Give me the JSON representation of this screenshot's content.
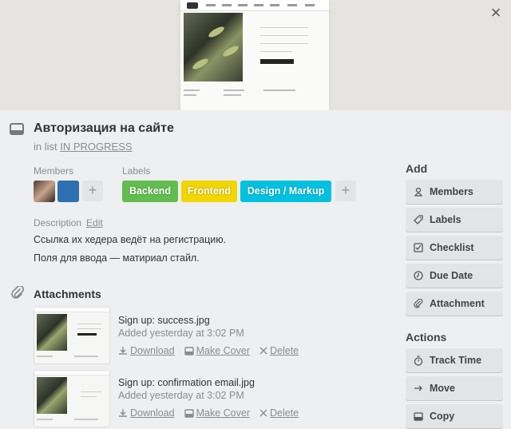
{
  "card": {
    "title": "Авторизация на сайте",
    "in_list_prefix": "in list",
    "list_name": "IN PROGRESS"
  },
  "members": {
    "label": "Members",
    "add": "+"
  },
  "labels": {
    "label": "Labels",
    "items": [
      {
        "text": "Backend",
        "color": "#61bd4f"
      },
      {
        "text": "Frontend",
        "color": "#f2d600"
      },
      {
        "text": "Design / Markup",
        "color": "#00c2e0"
      }
    ],
    "add": "+"
  },
  "description": {
    "label": "Description",
    "edit": "Edit",
    "lines": [
      "Ссылка их хедера ведёт на регистрацию.",
      "Поля для ввода — матириал стайл."
    ]
  },
  "attachments": {
    "title": "Attachments",
    "items": [
      {
        "name": "Sign up: success.jpg",
        "added": "Added yesterday at 3:02 PM"
      },
      {
        "name": "Sign up: confirmation email.jpg",
        "added": "Added yesterday at 3:02 PM"
      }
    ],
    "actions": {
      "download": "Download",
      "make_cover": "Make Cover",
      "delete": "Delete"
    }
  },
  "sidebar": {
    "add_title": "Add",
    "add_buttons": [
      {
        "label": "Members",
        "icon": "person-icon"
      },
      {
        "label": "Labels",
        "icon": "tag-icon"
      },
      {
        "label": "Checklist",
        "icon": "checkbox-icon"
      },
      {
        "label": "Due Date",
        "icon": "clock-icon"
      },
      {
        "label": "Attachment",
        "icon": "paperclip-icon"
      }
    ],
    "actions_title": "Actions",
    "action_buttons": [
      {
        "label": "Track Time",
        "icon": "stopwatch-icon"
      },
      {
        "label": "Move",
        "icon": "arrow-right-icon"
      },
      {
        "label": "Copy",
        "icon": "card-icon"
      }
    ]
  },
  "close": "×"
}
